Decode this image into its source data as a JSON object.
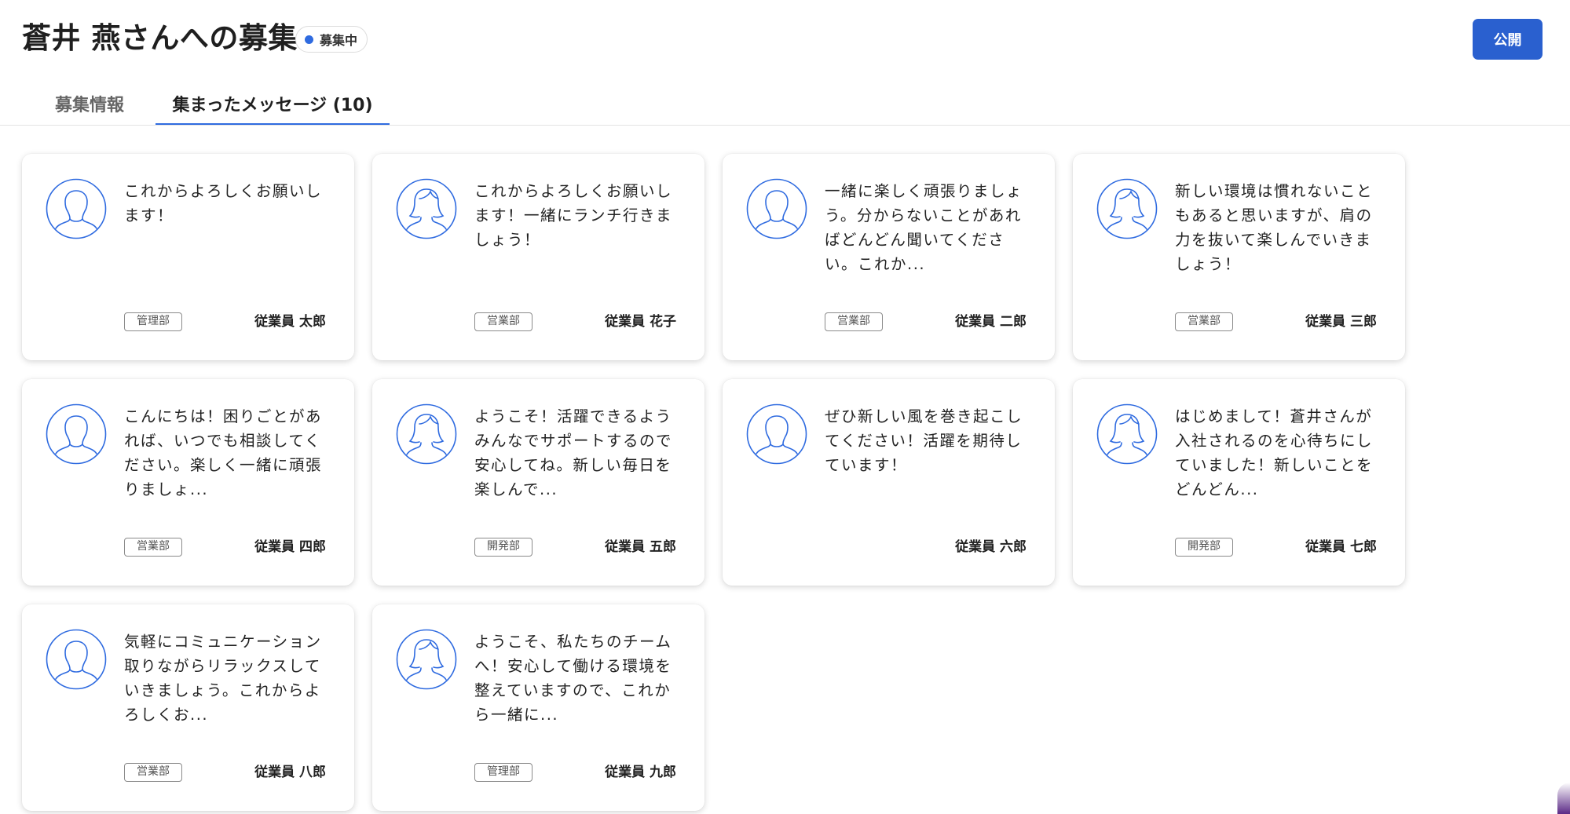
{
  "header": {
    "title": "蒼井 燕さんへの募集",
    "status_label": "募集中",
    "publish_label": "公開"
  },
  "tabs": [
    {
      "label": "募集情報",
      "active": false
    },
    {
      "label": "集まったメッセージ (10)",
      "active": true
    }
  ],
  "colors": {
    "accent": "#2a60cf",
    "status_dot": "#2f6be0"
  },
  "messages": [
    {
      "text": "これからよろしくお願いします！",
      "department": "管理部",
      "name": "従業員 太郎",
      "avatar": "male-avatar-icon"
    },
    {
      "text": "これからよろしくお願いします！一緒にランチ行きましょう！",
      "department": "営業部",
      "name": "従業員 花子",
      "avatar": "female-avatar-icon"
    },
    {
      "text": "一緒に楽しく頑張りましょう。分からないことがあればどんどん聞いてください。これか...",
      "department": "営業部",
      "name": "従業員 二郎",
      "avatar": "male-avatar-icon"
    },
    {
      "text": "新しい環境は慣れないこともあると思いますが、肩の力を抜いて楽しんでいきましょう！",
      "department": "営業部",
      "name": "従業員 三郎",
      "avatar": "female-avatar-icon"
    },
    {
      "text": "こんにちは！困りごとがあれば、いつでも相談してください。楽しく一緒に頑張りましょ...",
      "department": "営業部",
      "name": "従業員 四郎",
      "avatar": "male-avatar-icon"
    },
    {
      "text": "ようこそ！活躍できるようみんなでサポートするので安心してね。新しい毎日を楽しんで...",
      "department": "開発部",
      "name": "従業員 五郎",
      "avatar": "female-avatar-icon"
    },
    {
      "text": "ぜひ新しい風を巻き起こしてください！活躍を期待しています！",
      "department": "",
      "name": "従業員 六郎",
      "avatar": "male-avatar-icon"
    },
    {
      "text": "はじめまして！蒼井さんが入社されるのを心待ちにしていました！新しいことをどんどん...",
      "department": "開発部",
      "name": "従業員 七郎",
      "avatar": "female-avatar-icon"
    },
    {
      "text": "気軽にコミュニケーション取りながらリラックスしていきましょう。これからよろしくお...",
      "department": "営業部",
      "name": "従業員 八郎",
      "avatar": "male-avatar-icon"
    },
    {
      "text": "ようこそ、私たちのチームへ！安心して働ける環境を整えていますので、これから一緒に...",
      "department": "管理部",
      "name": "従業員 九郎",
      "avatar": "female-avatar-icon"
    }
  ]
}
